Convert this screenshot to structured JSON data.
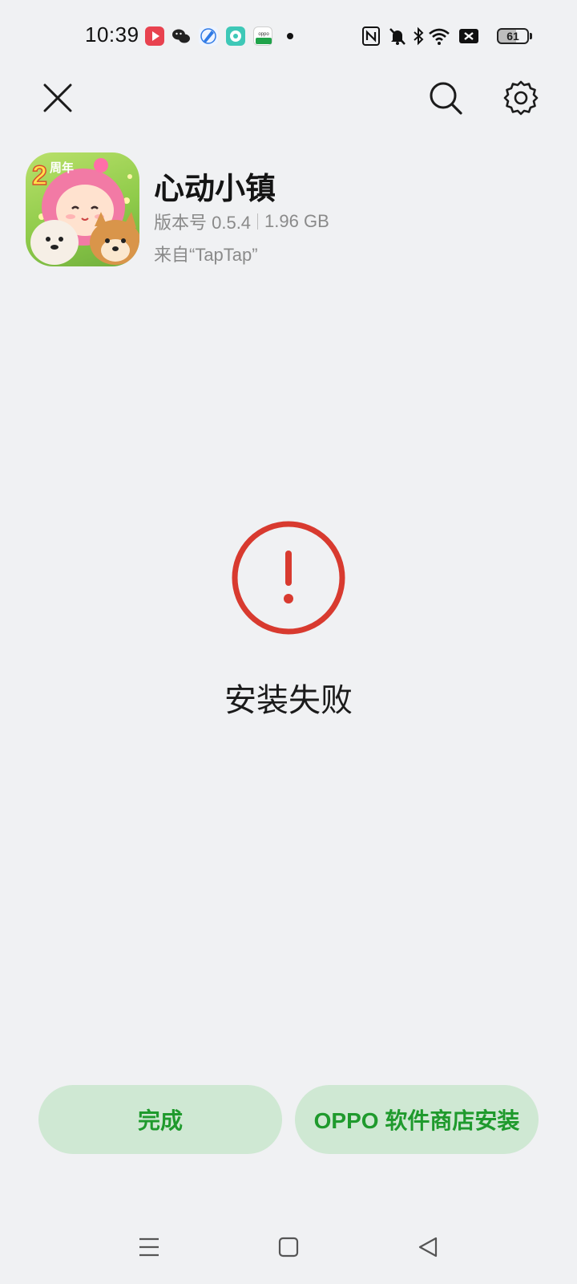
{
  "status_bar": {
    "time": "10:39",
    "battery_level": "61",
    "notification_icons": [
      "video-app-icon",
      "wechat-icon",
      "browser-icon",
      "chat-app-icon",
      "oppo-store-icon",
      "dot-icon"
    ],
    "system_icons": [
      "nfc-icon",
      "mute-icon",
      "bluetooth-icon",
      "wifi-icon",
      "sim-off-icon",
      "battery-icon"
    ]
  },
  "toolbar": {
    "close_icon": "close-icon",
    "search_icon": "search-icon",
    "settings_icon": "gear-icon"
  },
  "app": {
    "name": "心动小镇",
    "version_label": "版本号 0.5.4",
    "size": "1.96 GB",
    "source": "来自“TapTap”",
    "icon_badge_number": "2",
    "icon_badge_text": "周年"
  },
  "result": {
    "icon": "error-icon",
    "message": "安装失败"
  },
  "buttons": {
    "done_label": "完成",
    "store_label": "OPPO 软件商店安装"
  },
  "colors": {
    "accent_green": "#1f9a2d",
    "button_bg": "#cfe8d3",
    "error_red": "#d83a2f",
    "background": "#f0f1f3"
  },
  "navbar": [
    "menu-icon",
    "home-icon",
    "back-icon"
  ]
}
